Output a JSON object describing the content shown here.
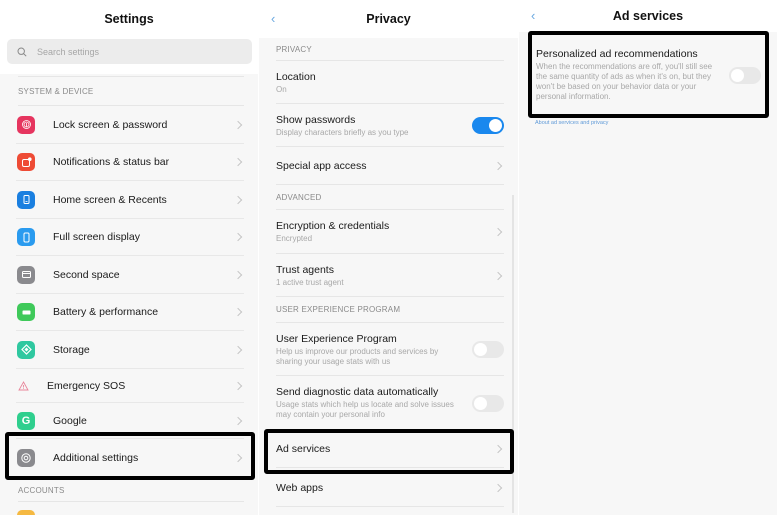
{
  "settings": {
    "title": "Settings",
    "search_placeholder": "Search settings",
    "section_system": "SYSTEM & DEVICE",
    "items": [
      {
        "label": "Lock screen & password",
        "icon": "fingerprint-icon",
        "color": "#e6355f"
      },
      {
        "label": "Notifications & status bar",
        "icon": "notification-icon",
        "color": "#ee4b35"
      },
      {
        "label": "Home screen & Recents",
        "icon": "home-screen-icon",
        "color": "#1a7fe0"
      },
      {
        "label": "Full screen display",
        "icon": "full-screen-icon",
        "color": "#2a9bef"
      },
      {
        "label": "Second space",
        "icon": "second-space-icon",
        "color": "#8a8a8e"
      },
      {
        "label": "Battery & performance",
        "icon": "battery-icon",
        "color": "#3fc95a"
      },
      {
        "label": "Storage",
        "icon": "storage-icon",
        "color": "#2fc8a0"
      },
      {
        "label": "Emergency SOS",
        "icon": "warning-icon",
        "color": "#e8859a"
      },
      {
        "label": "Google",
        "icon": "google-icon",
        "color": "#2fcf8e"
      },
      {
        "label": "Additional settings",
        "icon": "gear-icon",
        "color": "#8a8a8e"
      }
    ],
    "section_accounts": "ACCOUNTS"
  },
  "privacy": {
    "title": "Privacy",
    "section_privacy": "PRIVACY",
    "location": {
      "label": "Location",
      "sub": "On"
    },
    "show_passwords": {
      "label": "Show passwords",
      "sub": "Display characters briefly as you type",
      "enabled": true
    },
    "special_app_access": {
      "label": "Special app access"
    },
    "section_advanced": "ADVANCED",
    "encryption": {
      "label": "Encryption & credentials",
      "sub": "Encrypted"
    },
    "trust_agents": {
      "label": "Trust agents",
      "sub": "1 active trust agent"
    },
    "section_uep": "USER EXPERIENCE PROGRAM",
    "uep": {
      "label": "User Experience Program",
      "sub": "Help us improve our products and services by sharing your usage stats with us",
      "enabled": false
    },
    "diagnostic": {
      "label": "Send diagnostic data automatically",
      "sub": "Usage stats which help us locate and solve issues may contain your personal info",
      "enabled": false
    },
    "ad_services": {
      "label": "Ad services"
    },
    "web_apps": {
      "label": "Web apps"
    }
  },
  "ad_services": {
    "title": "Ad services",
    "personalized": {
      "label": "Personalized ad recommendations",
      "sub": "When the recommendations are off, you'll still see the same quantity of ads as when it's on, but they won't be based on your behavior data or your personal information.",
      "enabled": false
    },
    "about_link": "About ad services and privacy"
  },
  "colors": {
    "accent": "#1a88ee",
    "link": "#5f9ad8",
    "highlight_border": "#000000"
  }
}
